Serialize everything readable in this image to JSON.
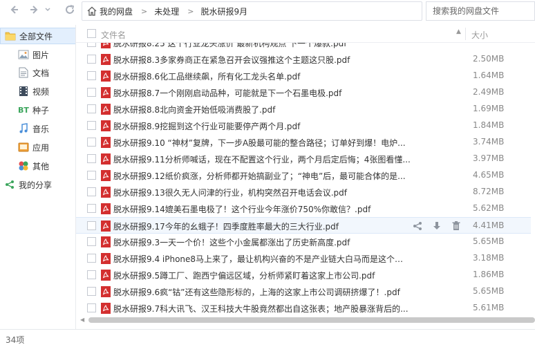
{
  "nav": {
    "back_icon": "arrow-left-icon",
    "forward_icon": "arrow-right-icon",
    "dropdown_icon": "chevron-down-icon",
    "refresh_icon": "refresh-icon"
  },
  "breadcrumb": {
    "home_icon": "home-icon",
    "items": [
      "我的网盘",
      "未处理",
      "脱水研报9月"
    ],
    "separator": ">"
  },
  "search": {
    "placeholder": "搜索我的网盘文件"
  },
  "sidebar": {
    "items": [
      {
        "label": "全部文件",
        "icon": "folder-icon",
        "active": true
      },
      {
        "label": "图片",
        "icon": "image-icon"
      },
      {
        "label": "文档",
        "icon": "document-icon"
      },
      {
        "label": "视频",
        "icon": "video-icon"
      },
      {
        "label": "种子",
        "icon": "bt-icon",
        "icon_text": "BT"
      },
      {
        "label": "音乐",
        "icon": "music-icon"
      },
      {
        "label": "应用",
        "icon": "app-icon"
      },
      {
        "label": "其他",
        "icon": "other-icon"
      },
      {
        "label": "我的分享",
        "icon": "share-icon"
      }
    ]
  },
  "list": {
    "header": {
      "name": "文件名",
      "size": "大小",
      "sort_icon": "sort-asc-icon"
    },
    "files": [
      {
        "name": "脱水研报8.3多家券商正在紧急召开会议强推这个主题这只股.pdf",
        "size": "2.50MB"
      },
      {
        "name": "脱水研报8.6化工品继续飙，所有化工龙头名单.pdf",
        "size": "1.64MB"
      },
      {
        "name": "脱水研报8.7一个刚刚启动品种，可能就是下一个石墨电极.pdf",
        "size": "2.49MB"
      },
      {
        "name": "脱水研报8.8北向资金开始低吸消费股了.pdf",
        "size": "1.69MB"
      },
      {
        "name": "脱水研报8.9挖掘到这个行业可能要停产两个月.pdf",
        "size": "1.84MB"
      },
      {
        "name": "脱水研报9.10 “神材”复牌，下一步A股最可能的整合路径；订单好到爆！电炉...",
        "size": "3.74MB"
      },
      {
        "name": "脱水研报9.11分析师喊话，现在不配置这个行业，两个月后定后悔；4张图看懂...",
        "size": "3.97MB"
      },
      {
        "name": "脱水研报9.12纸价疯涨，分析师都开始搞副业了；“神电”后，最可能合体的是...",
        "size": "4.65MB"
      },
      {
        "name": "脱水研报9.13很久无人问津的行业，机构突然召开电话会议.pdf",
        "size": "8.72MB"
      },
      {
        "name": "脱水研报9.14媲美石墨电极了！这个行业今年涨价750%你敢信？.pdf",
        "size": "5.62MB"
      },
      {
        "name": "脱水研报9.17今年的幺蛾子！四季度胜率最大的三大行业.pdf",
        "size": "4.41MB",
        "hover": true
      },
      {
        "name": "脱水研报9.3一天一个价！这些个小金属都涨出了历史新高度.pdf",
        "size": "5.65MB"
      },
      {
        "name": "脱水研报9.4 iPhone8马上来了，最让机构兴奋的不是产业链大白马而是这个小...",
        "size": "3.18MB"
      },
      {
        "name": "脱水研报9.5蹲工厂、跑西宁偏远区域，分析师紧盯着这家上市公司.pdf",
        "size": "1.86MB"
      },
      {
        "name": "脱水研报9.6疯“钴”还有这些隐形标的，上海的这家上市公司调研挤爆了！.pdf",
        "size": "5.65MB"
      },
      {
        "name": "脱水研报9.7科大讯飞、汉王科技大牛股竟然都出自这张表；地产股暴涨背后的...",
        "size": "5.61MB"
      }
    ],
    "partial_row_name": "脱水研报8.25 这个行业龙头涨价 最新机构观点 下一个爆款.pdf",
    "row_action_icons": [
      "share-icon",
      "download-icon",
      "trash-icon"
    ]
  },
  "status": {
    "count": "34项"
  },
  "colors": {
    "pdf_red": "#d32f2f",
    "active_bg": "#e3effd",
    "hover_bg": "#f2f7fd",
    "text": "#333333",
    "muted": "#999999"
  }
}
